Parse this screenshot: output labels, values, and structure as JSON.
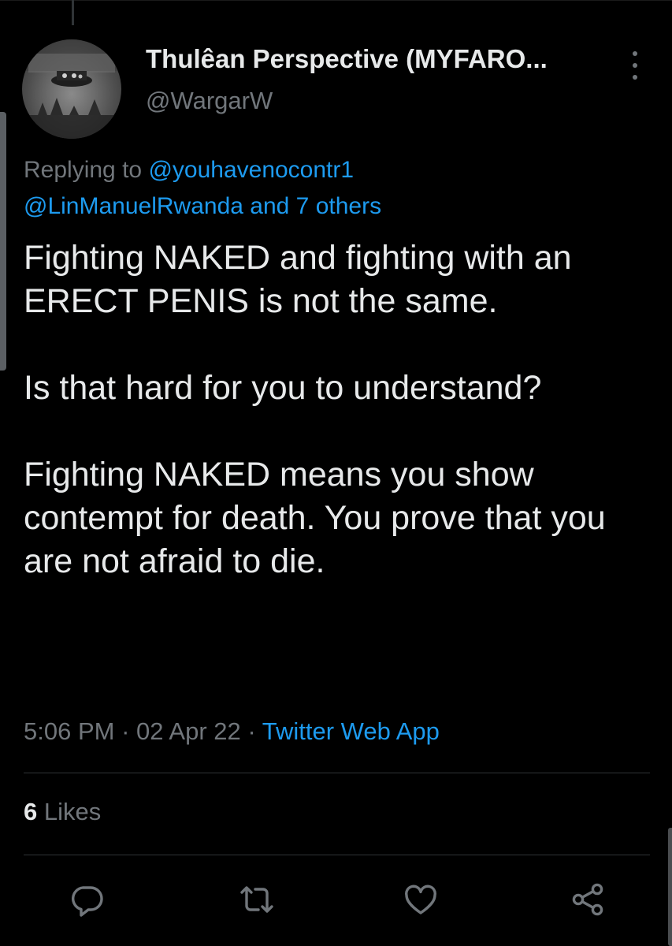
{
  "tweet": {
    "author": {
      "display_name": "Thulêan Perspective (MYFARO...",
      "handle": "@WargarW"
    },
    "replying": {
      "prefix": "Replying to",
      "mention_1": "@youhavenocontr1",
      "mention_2": "@LinManuelRwanda",
      "others": "and 7 others"
    },
    "paragraphs": [
      "Fighting NAKED and fighting with an ERECT PENIS is not the same.",
      "Is that hard for you to understand?",
      "Fighting NAKED means you show contempt for death. You prove that you are not afraid to die."
    ],
    "time": "5:06 PM",
    "date": "02 Apr 22",
    "source": "Twitter Web App",
    "separator": " · ",
    "likes_count": "6",
    "likes_label": "Likes"
  },
  "actions": [
    {
      "icon": "reply-icon"
    },
    {
      "icon": "retweet-icon"
    },
    {
      "icon": "like-icon"
    },
    {
      "icon": "share-icon"
    }
  ],
  "colors": {
    "background": "#000000",
    "text": "#e7e9ea",
    "muted": "#71767b",
    "link": "#1d9bf0",
    "divider": "#2f3336"
  }
}
